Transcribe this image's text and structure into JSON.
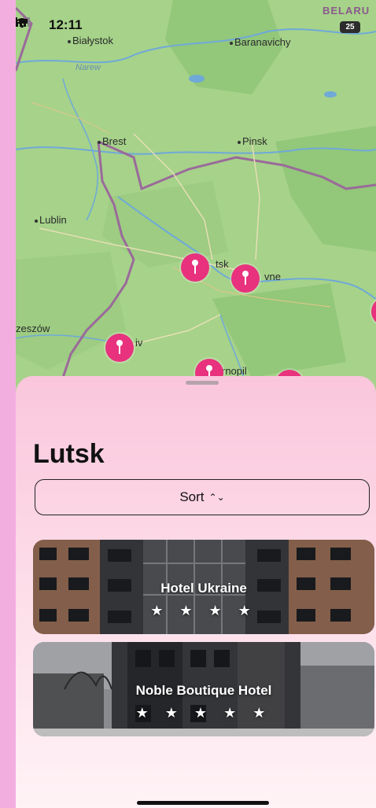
{
  "status_bar": {
    "time": "12:11",
    "battery": "25"
  },
  "map": {
    "cities": [
      {
        "name": "Białystok"
      },
      {
        "name": "Baranavichy"
      },
      {
        "name": "Brest"
      },
      {
        "name": "Pinsk"
      },
      {
        "name": "Lublin"
      },
      {
        "name": "tsk"
      },
      {
        "name": "vne"
      },
      {
        "name": "zeszów"
      },
      {
        "name": "iv"
      },
      {
        "name": "rnopil"
      }
    ],
    "river_label": "Narew",
    "region_label": "BELARU",
    "pin_color": "#e8327e"
  },
  "sheet": {
    "title": "Lutsk",
    "sort_label": "Sort",
    "hotels": [
      {
        "name": "Hotel Ukraine",
        "stars": "★ ★ ★ ★",
        "rating": 4
      },
      {
        "name": "Noble Boutique Hotel",
        "stars": "★ ★ ★ ★ ★",
        "rating": 5
      }
    ]
  },
  "colors": {
    "sheet_top": "#fac6dc",
    "accent": "#e8327e",
    "map_land": "#a6d28a"
  }
}
